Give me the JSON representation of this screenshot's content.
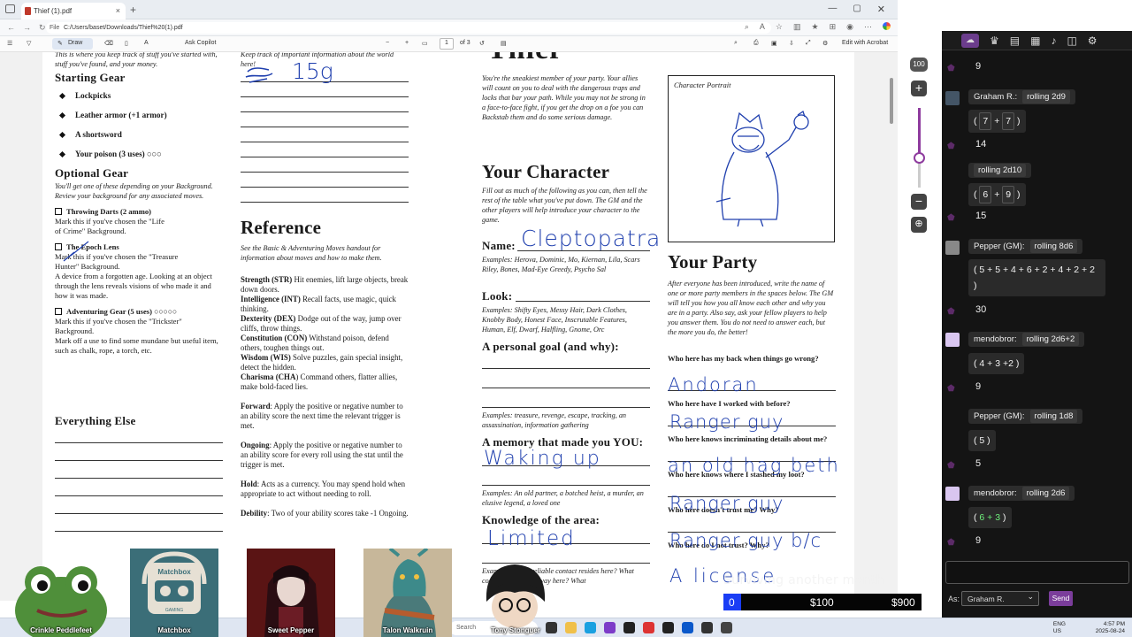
{
  "browser": {
    "tab_title": "Thief (1).pdf",
    "file_label": "File",
    "url": "C:/Users/baset/Downloads/Thief%20(1).pdf",
    "new_tab": "+",
    "tab_close": "×"
  },
  "pdf_toolbar": {
    "draw_label": "Draw",
    "ask_copilot": "Ask Copilot",
    "page_current": "1",
    "page_total": "of 3",
    "edit_acrobat": "Edit with Acrobat"
  },
  "sheet": {
    "col1": {
      "intro": "This is where you keep track of stuff you've started with, stuff you've found, and your money.",
      "starting_gear_title": "Starting Gear",
      "starting_gear": [
        "Lockpicks",
        "Leather armor (+1 armor)",
        "A shortsword",
        "Your poison (3 uses) ○○○"
      ],
      "optional_gear_title": "Optional Gear",
      "optional_gear_desc": "You'll get one of these depending on your Background. Review your background for any associated moves.",
      "throwing_darts": "Throwing Darts (2 ammo)",
      "throwing_darts_desc": "Mark this if you've chosen the \"Life of Crime\" Background.",
      "epoch_lens": "The Epoch Lens",
      "epoch_lens_desc": "Mark this if you've chosen the \"Treasure Hunter\" Background.",
      "epoch_lens_desc2": "A device from a forgotten age. Looking at an object through the lens reveals visions of who made it and how it was made.",
      "adventuring_gear": "Adventuring Gear (5 uses) ○○○○○",
      "adventuring_gear_desc": "Mark this if you've chosen the \"Trickster\" Background.",
      "adventuring_gear_desc2": "Mark off a use to find some mundane but useful item, such as chalk, rope, a torch, etc.",
      "everything_else_title": "Everything Else"
    },
    "col2": {
      "intro": "Keep track of important information about the world here!",
      "handwriting_money": "15g",
      "reference_title": "Reference",
      "reference_desc": "See the Basic & Adventuring Moves handout for information about moves and how to make them.",
      "stats": [
        {
          "name": "Strength (STR)",
          "text": " Hit enemies, lift large objects, break down doors."
        },
        {
          "name": "Intelligence (INT)",
          "text": " Recall facts, use magic, quick thinking."
        },
        {
          "name": "Dexterity (DEX)",
          "text": "  Dodge out of the way, jump over cliffs, throw things."
        },
        {
          "name": "Constitution (CON)",
          "text": " Withstand poison, defend others, toughen things out."
        },
        {
          "name": "Wisdom (WIS)",
          "text": "  Solve puzzles, gain special insight, detect the hidden."
        },
        {
          "name": "Charisma (CHA",
          "text": ") Command others, flatter allies, make bold-faced lies."
        }
      ],
      "forward": {
        "name": "Forward",
        "text": ": Apply the positive or negative number to an ability score the next time the relevant trigger is met."
      },
      "ongoing": {
        "name": "Ongoing",
        "text": ": Apply the positive or negative number to an ability score for every roll using the stat until the trigger is met."
      },
      "hold": {
        "name": "Hold",
        "text": ": Acts as a currency. You may spend hold when appropriate to act without needing to roll."
      },
      "debility": {
        "name": "Debility",
        "text": ": Two of your ability scores take -1 Ongoing."
      }
    },
    "col3": {
      "title": "Thief",
      "intro": "You're the sneakiest member of your party. Your allies will count on you to deal with the dangerous traps and locks that bar your path. While you may not be strong in a face-to-face fight, if you get the drop on a foe you can Backstab them and do some serious damage.",
      "your_character_title": "Your Character",
      "your_character_desc": "Fill out as much of the following as you can, then tell the rest of the table what you've put down. The GM and the other players will help introduce your character to the game.",
      "name_label": "Name:",
      "name_value": "Cleptopatra",
      "name_examples": "Examples: Herova, Dominic, Mo, Kiernan, Lila, Scars Riley, Bones, Mad-Eye Greedy, Psycho Sal",
      "look_label": "Look:",
      "look_examples": "Examples: Shifty Eyes, Messy Hair, Dark Clothes, Knobby Body, Honest Face, Inscrutable Features, Human, Elf, Dwarf, Halfling, Gnome, Orc",
      "goal_label": "A personal goal (and why):",
      "goal_examples": "Examples: treasure, revenge, escape, tracking, an assassination, information gathering",
      "memory_label": "A memory that made you YOU:",
      "memory_value": "Waking up",
      "memory_examples": "Examples: An old partner, a botched heist, a murder, an elusive legend, a loved one",
      "knowledge_label": "Knowledge of the area:",
      "knowledge_value": "Limited",
      "knowledge_examples": "Examples: What reliable contact resides here? What cooperation holds sway here? What"
    },
    "col4": {
      "portrait_label": "Character Portrait",
      "party_title": "Your Party",
      "party_desc": "After everyone has been introduced, write the name of one or more party members in the spaces below. The GM will tell you how you all know each other and why you are in a party. Also say, ask your fellow players to help you answer them. You do not need to answer each, but the more you do, the better!",
      "questions": [
        {
          "q": "Who here has my back when things go wrong?",
          "a": "Andoran"
        },
        {
          "q": "Who here have I worked with before?",
          "a": "Ranger guy"
        },
        {
          "q": "Who here knows incriminating details about me?",
          "a": "an old hag beth"
        },
        {
          "q": "Who here knows where I stashed my loot?",
          "a": "Ranger guy"
        },
        {
          "q": "Who here doesn't trust me? Why?",
          "a": "Ranger guy b/c"
        },
        {
          "q": "Who here do I not trust? Why?",
          "a": "A license"
        }
      ]
    }
  },
  "zoom": {
    "level": "100",
    "plus": "+",
    "minus": "−",
    "slider_fraction": 0.62
  },
  "chat": {
    "messages": [
      {
        "type": "number",
        "value": "9"
      },
      {
        "type": "roll",
        "who": "Graham R.:",
        "roll": "rolling 2d9"
      },
      {
        "type": "result",
        "parts": [
          "7",
          "+",
          "7"
        ]
      },
      {
        "type": "number",
        "value": "14"
      },
      {
        "type": "roll",
        "who": "",
        "roll": "rolling 2d10"
      },
      {
        "type": "result",
        "parts": [
          "6",
          "+",
          "9"
        ]
      },
      {
        "type": "number",
        "value": "15"
      },
      {
        "type": "roll",
        "who": "Pepper (GM):",
        "roll": "rolling 8d6"
      },
      {
        "type": "result",
        "text": "5 + 5 + 4 + 6 + 2 + 4 + 2 + 2"
      },
      {
        "type": "number",
        "value": "30"
      },
      {
        "type": "roll",
        "who": "mendobror:",
        "roll": "rolling 2d6+2"
      },
      {
        "type": "result",
        "text": "4 + 3 +2"
      },
      {
        "type": "number",
        "value": "9"
      },
      {
        "type": "roll",
        "who": "Pepper (GM):",
        "roll": "rolling 1d8"
      },
      {
        "type": "result",
        "text": "5"
      },
      {
        "type": "number",
        "value": "5"
      },
      {
        "type": "roll",
        "who": "mendobror:",
        "roll": "rolling 2d6"
      },
      {
        "type": "result",
        "text": "6 + 3"
      },
      {
        "type": "number",
        "value": "9"
      }
    ],
    "as_label": "As:",
    "as_value": "Graham R.",
    "send_label": "Send"
  },
  "stream": {
    "caption": "Surviving another month",
    "goal_current": "0",
    "goal_mid": "$100",
    "goal_max": "$900",
    "goal_fraction": 0.0,
    "cams": [
      {
        "name": "Crinkle Peddlefeet"
      },
      {
        "name": "Matchbox"
      },
      {
        "name": "Sweet Pepper"
      },
      {
        "name": "Talon Walkruin"
      },
      {
        "name": "Tony Stonguer"
      }
    ],
    "matchbox_logo_top": "Matchbox",
    "matchbox_logo_sub": "GAMING"
  },
  "taskbar": {
    "search_placeholder": "Search",
    "lang": "ENG",
    "region": "US",
    "time": "4:57 PM",
    "date": "2025-08-24"
  },
  "colors": {
    "handwriting": "#1f3fae",
    "panel_bg": "#141414",
    "accent_purple": "#7b3d9b",
    "goal_fill": "#1a3df5",
    "dice_highlight": "#6ef07b"
  }
}
